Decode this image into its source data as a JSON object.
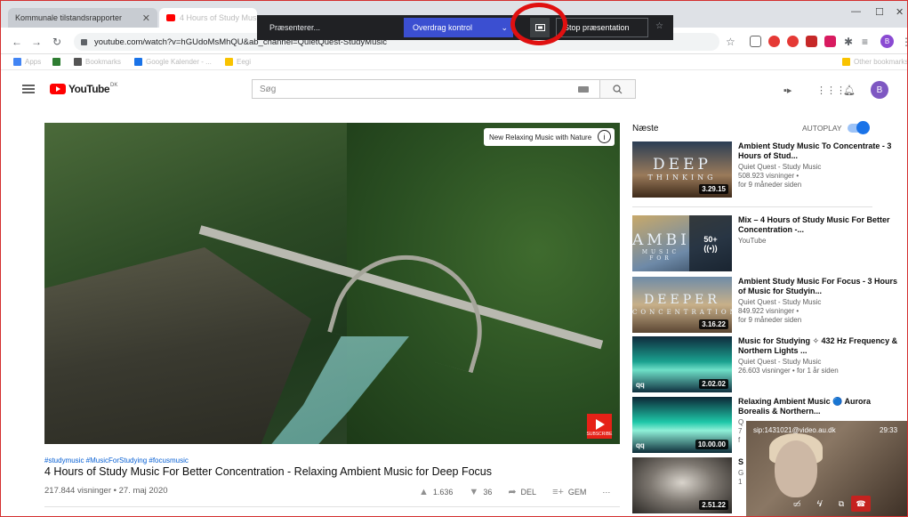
{
  "browser": {
    "tabs": [
      {
        "label": "Kommunale tilstandsrapporter"
      },
      {
        "label": "4 Hours of Study Music F"
      }
    ],
    "tab_close": "✕",
    "url": "youtube.com/watch?v=hGUdoMsMhQU&ab_channel=QuietQuest-StudyMusic",
    "bookmarks": [
      {
        "label": "Apps"
      },
      {
        "label": "Bookmarks"
      },
      {
        "label": "Google Kalender - ..."
      },
      {
        "label": "Eegi"
      },
      {
        "label": "Other bookmarks"
      }
    ],
    "profile_initial": "B"
  },
  "presenting_bar": {
    "status": "Præsenterer...",
    "handover": "Overdrag kontrol",
    "stop": "Stop præsentation"
  },
  "youtube": {
    "logo_text": "YouTube",
    "country": "DK",
    "search_placeholder": "Søg",
    "avatar_initial": "B",
    "video": {
      "overlay_chip": "New Relaxing Music with Nature",
      "info_glyph": "i",
      "subscribe": "SUBSCRIBE",
      "hashtags": "#studymusic #MusicForStudying #focusmusic",
      "title": "4 Hours of Study Music For Better Concentration - Relaxing Ambient Music for Deep Focus",
      "views": "217.844 visninger • 27. maj 2020",
      "likes": "1.636",
      "dislikes": "36",
      "share": "DEL",
      "save": "GEM",
      "more": "···"
    },
    "sidebar": {
      "up_next": "Næste",
      "autoplay": "AUTOPLAY",
      "autoplay_on": true,
      "recommendations": [
        {
          "title": "Ambient Study Music To Concentrate - 3 Hours of Stud...",
          "channel": "Quiet Quest - Study Music",
          "views": "508.923 visninger •",
          "age": "for 9 måneder siden",
          "duration": "3.29.15",
          "thumb_line1": "DEEP",
          "thumb_line2": "THINKING"
        },
        {
          "title": "Mix – 4 Hours of Study Music For Better Concentration -...",
          "channel": "YouTube",
          "views": "",
          "age": "",
          "duration": "",
          "thumb_line1": "AMBI",
          "thumb_line2": "MUSIC FOR",
          "mix_count": "50+",
          "mix_glyph": "((•))"
        },
        {
          "title": "Ambient Study Music For Focus - 3 Hours of Music for Studyin...",
          "channel": "Quiet Quest - Study Music",
          "views": "849.922 visninger •",
          "age": "for 9 måneder siden",
          "duration": "3.16.22",
          "thumb_line1": "DEEPER",
          "thumb_line2": "CONCENTRATION"
        },
        {
          "title": "Music for Studying ✧ 432 Hz Frequency & Northern Lights ...",
          "channel": "Quiet Quest - Study Music",
          "views": "26.603 visninger • for 1 år siden",
          "age": "",
          "duration": "2.02.02",
          "logo": "qq"
        },
        {
          "title": "Relaxing Ambient Music 🔵 Aurora Borealis & Northern...",
          "channel": "Q",
          "views": "7",
          "age": "f",
          "duration": "10.00.00",
          "logo": "qq"
        },
        {
          "title": "S M",
          "channel": "G",
          "views": "1",
          "age": "",
          "duration": "2.51.22"
        }
      ]
    }
  },
  "meet": {
    "sip": "sip:1431021@video.au.dk",
    "time": "29:33"
  },
  "colors": {
    "accent_red": "#ff0000",
    "meet_blue": "#3b4fd1",
    "annotation_circle": "#e01010"
  }
}
